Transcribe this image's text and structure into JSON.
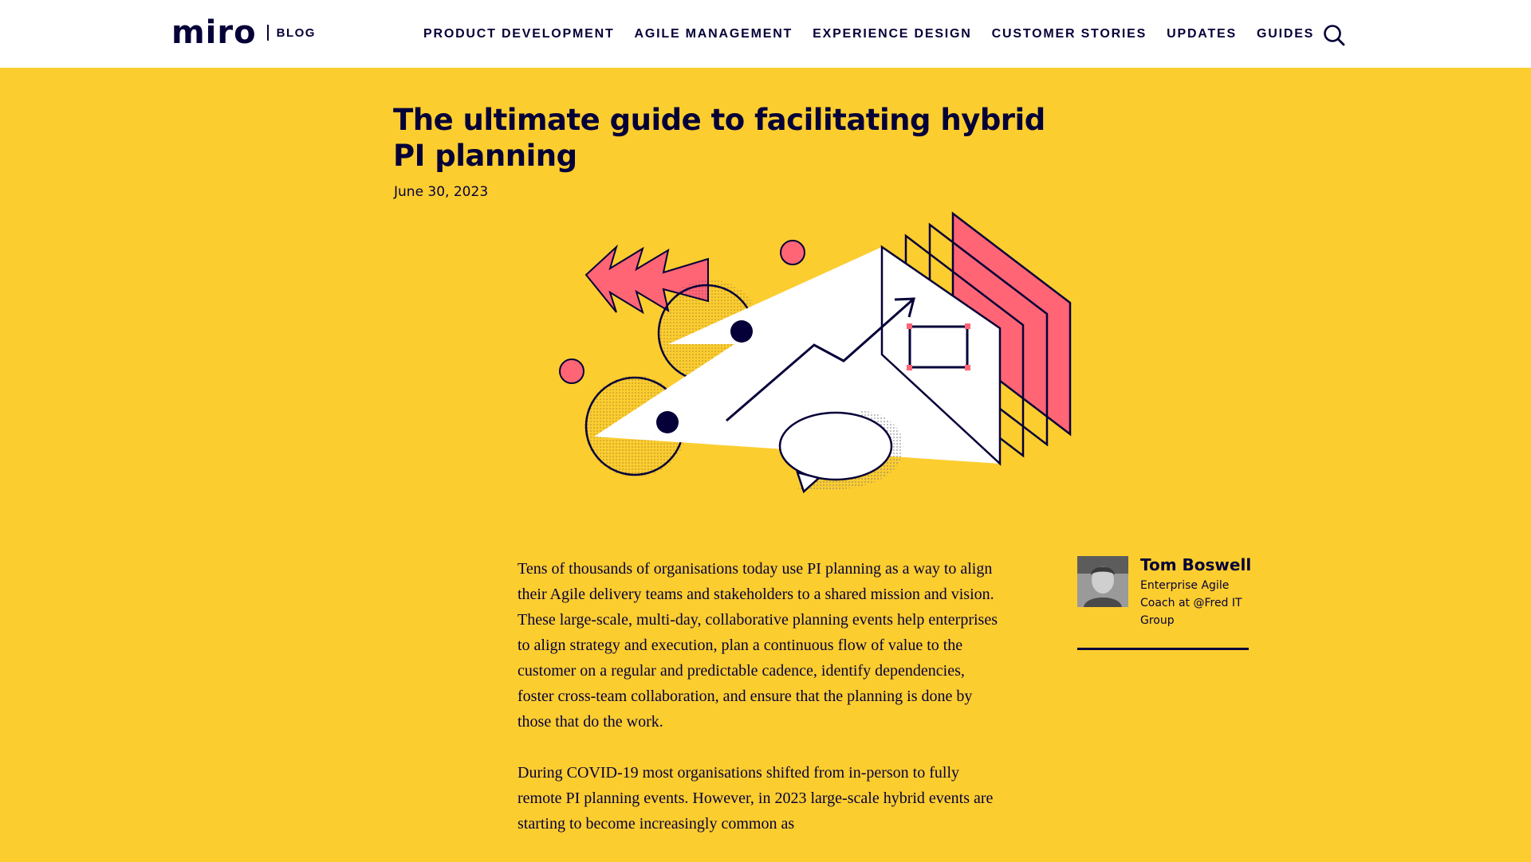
{
  "header": {
    "logo_text": "miro",
    "logo_sub": "BLOG",
    "nav": [
      {
        "label": "PRODUCT DEVELOPMENT"
      },
      {
        "label": "AGILE MANAGEMENT"
      },
      {
        "label": "EXPERIENCE DESIGN"
      },
      {
        "label": "CUSTOMER STORIES"
      },
      {
        "label": "UPDATES"
      },
      {
        "label": "GUIDES"
      }
    ],
    "search_icon": "search-icon"
  },
  "article": {
    "title": "The ultimate guide to facilitating hybrid PI planning",
    "date": "June 30, 2023",
    "paragraphs": [
      "Tens of thousands of organisations today use PI planning as a way to align their Agile delivery teams and stakeholders to a shared mission and vision. These large-scale, multi-day, collaborative planning events help enterprises to align strategy and execution, plan a continuous flow of value to the customer on a regular and predictable cadence, identify dependencies, foster cross-team collaboration, and ensure that the planning is done by those that do the work.",
      "During COVID-19 most organisations shifted from in-person to fully remote PI planning events. However, in 2023 large-scale hybrid events are starting to become increasingly common as"
    ]
  },
  "author": {
    "name": "Tom Boswell",
    "role": "Enterprise Agile Coach at @Fred IT Group"
  },
  "colors": {
    "background": "#FCCD2F",
    "ink": "#050038",
    "accent_pink": "#FF6575",
    "header_bg": "#FFFFFF"
  }
}
